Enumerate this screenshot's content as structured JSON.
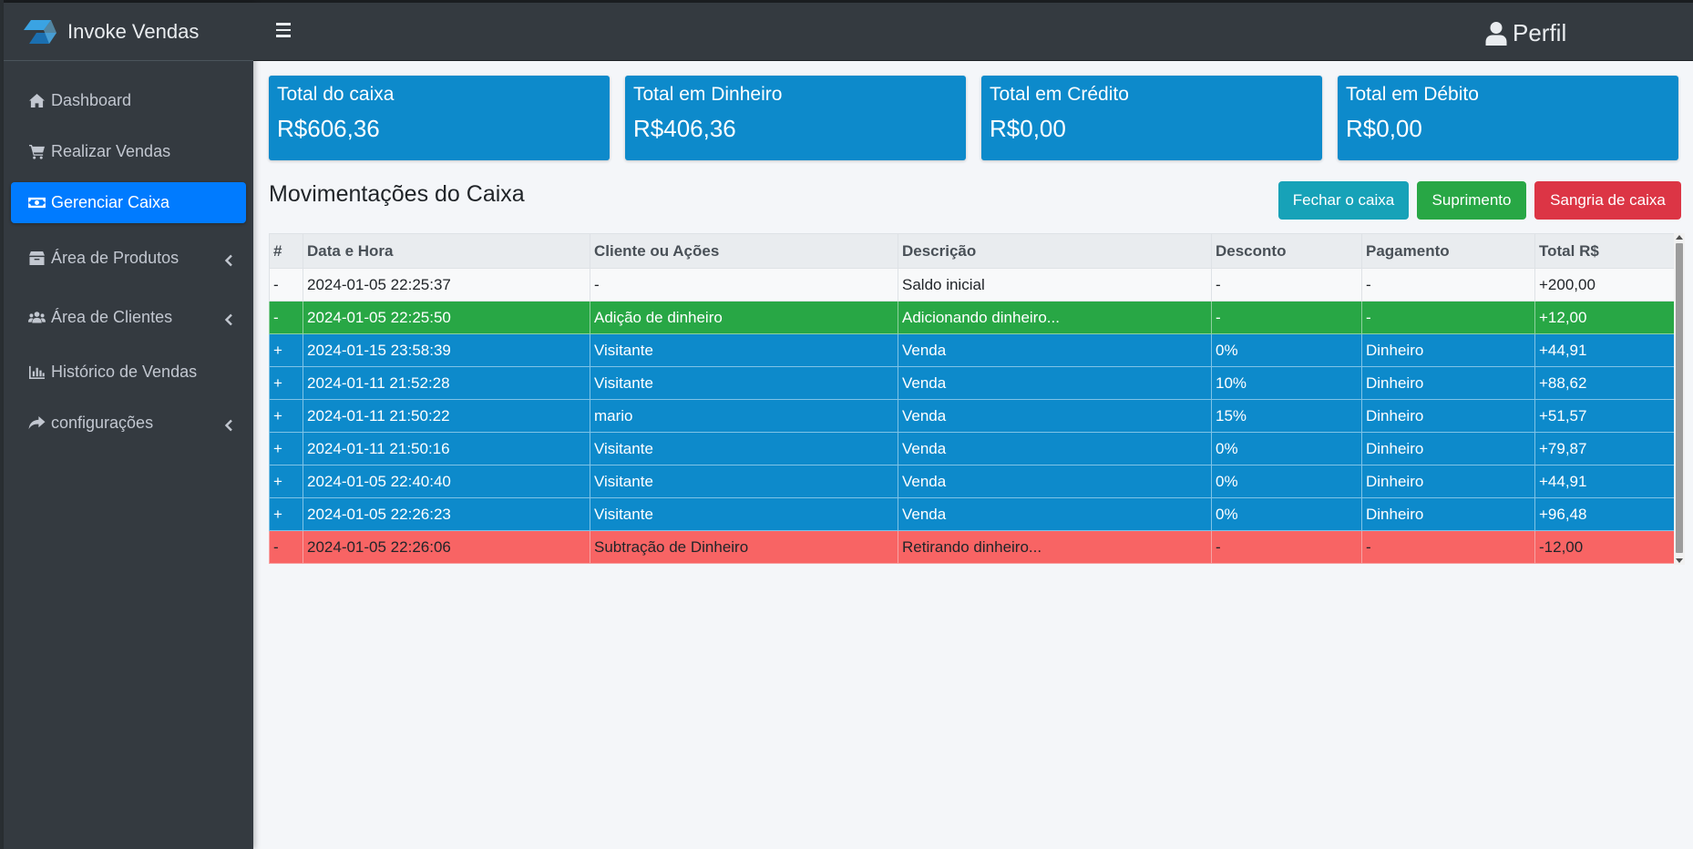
{
  "brand": {
    "name": "Invoke Vendas",
    "logo_icon": "layers-logo-icon"
  },
  "sidebar": {
    "items": [
      {
        "label": "Dashboard",
        "icon": "home-icon",
        "active": false,
        "has_submenu": false
      },
      {
        "label": "Realizar Vendas",
        "icon": "shopping-cart-icon",
        "active": false,
        "has_submenu": false
      },
      {
        "label": "Gerenciar Caixa",
        "icon": "money-bill-icon",
        "active": true,
        "has_submenu": false
      },
      {
        "label": "Área de Produtos",
        "icon": "box-icon",
        "active": false,
        "has_submenu": true
      },
      {
        "label": "Área de Clientes",
        "icon": "users-icon",
        "active": false,
        "has_submenu": true
      },
      {
        "label": "Histórico de Vendas",
        "icon": "chart-bar-icon",
        "active": false,
        "has_submenu": false
      },
      {
        "label": "configurações",
        "icon": "share-arrow-icon",
        "active": false,
        "has_submenu": true
      }
    ]
  },
  "navbar": {
    "profile_label": "Perfil",
    "profile_icon": "user-icon",
    "menu_icon": "hamburger-icon"
  },
  "cards": [
    {
      "title": "Total do caixa",
      "value": "R$606,36"
    },
    {
      "title": "Total em Dinheiro",
      "value": "R$406,36"
    },
    {
      "title": "Total em Crédito",
      "value": "R$0,00"
    },
    {
      "title": "Total em Débito",
      "value": "R$0,00"
    }
  ],
  "main": {
    "title": "Movimentações do Caixa",
    "buttons": {
      "fechar": "Fechar o caixa",
      "suprimento": "Suprimento",
      "sangria": "Sangria de caixa"
    }
  },
  "table": {
    "headers": [
      "#",
      "Data e Hora",
      "Cliente ou Ações",
      "Descrição",
      "Desconto",
      "Pagamento",
      "Total R$"
    ],
    "rows": [
      {
        "type": "white",
        "cells": [
          "-",
          "2024-01-05 22:25:37",
          "-",
          "Saldo inicial",
          "-",
          "-",
          "+200,00"
        ]
      },
      {
        "type": "green",
        "cells": [
          "-",
          "2024-01-05 22:25:50",
          "Adição de dinheiro",
          "Adicionando dinheiro...",
          "-",
          "-",
          "+12,00"
        ]
      },
      {
        "type": "blue",
        "cells": [
          "+",
          "2024-01-15 23:58:39",
          "Visitante",
          "Venda",
          "0%",
          "Dinheiro",
          "+44,91"
        ]
      },
      {
        "type": "blue",
        "cells": [
          "+",
          "2024-01-11 21:52:28",
          "Visitante",
          "Venda",
          "10%",
          "Dinheiro",
          "+88,62"
        ]
      },
      {
        "type": "blue",
        "cells": [
          "+",
          "2024-01-11 21:50:22",
          "mario",
          "Venda",
          "15%",
          "Dinheiro",
          "+51,57"
        ]
      },
      {
        "type": "blue",
        "cells": [
          "+",
          "2024-01-11 21:50:16",
          "Visitante",
          "Venda",
          "0%",
          "Dinheiro",
          "+79,87"
        ]
      },
      {
        "type": "blue",
        "cells": [
          "+",
          "2024-01-05 22:40:40",
          "Visitante",
          "Venda",
          "0%",
          "Dinheiro",
          "+44,91"
        ]
      },
      {
        "type": "blue",
        "cells": [
          "+",
          "2024-01-05 22:26:23",
          "Visitante",
          "Venda",
          "0%",
          "Dinheiro",
          "+96,48"
        ]
      },
      {
        "type": "red",
        "cells": [
          "-",
          "2024-01-05 22:26:06",
          "Subtração de Dinheiro",
          "Retirando dinheiro...",
          "-",
          "-",
          "-12,00"
        ]
      }
    ]
  },
  "colors": {
    "sidebar_bg": "#343a40",
    "active_nav": "#007bff",
    "card_bg": "#0d8acb",
    "row_green": "#28a745",
    "row_blue": "#0d8acb",
    "row_red": "#f86464",
    "btn_info": "#17a2b8",
    "btn_success": "#28a745",
    "btn_danger": "#dc3545"
  }
}
